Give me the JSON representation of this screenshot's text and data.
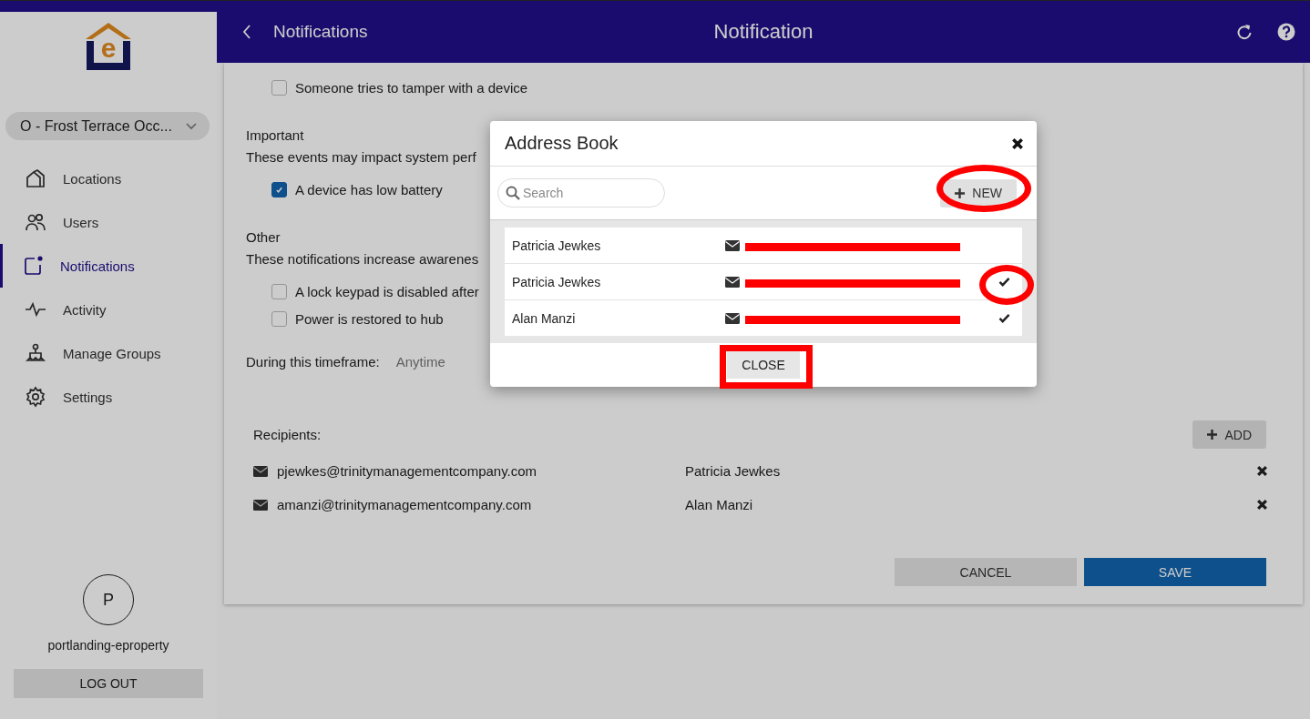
{
  "logo": {
    "letter": "e"
  },
  "location_selector": {
    "value": "O - Frost Terrace Occ..."
  },
  "sidebar": {
    "items": [
      {
        "label": "Locations",
        "selected": false
      },
      {
        "label": "Users",
        "selected": false
      },
      {
        "label": "Notifications",
        "selected": true
      },
      {
        "label": "Activity",
        "selected": false
      },
      {
        "label": "Manage Groups",
        "selected": false
      },
      {
        "label": "Settings",
        "selected": false
      }
    ]
  },
  "user": {
    "initial": "P",
    "name": "portlanding-eproperty",
    "logout": "LOG OUT"
  },
  "header": {
    "back_label": "Notifications",
    "title": "Notification"
  },
  "sections": [
    {
      "items": [
        {
          "label": "Someone tries to tamper with a device",
          "checked": false
        }
      ]
    },
    {
      "title": "Important",
      "description": "These events may impact system perf",
      "items": [
        {
          "label": "A device has low battery",
          "checked": true
        }
      ]
    },
    {
      "title": "Other",
      "description": "These notifications increase awarenes",
      "items": [
        {
          "label": "A lock keypad is disabled after",
          "checked": false
        },
        {
          "label": "Power is restored to hub",
          "checked": false
        }
      ]
    }
  ],
  "timeframe": {
    "label": "During this timeframe:",
    "value": "Anytime"
  },
  "recipients": {
    "label": "Recipients:",
    "add": "ADD",
    "items": [
      {
        "email": "pjewkes@trinitymanagementcompany.com",
        "name": "Patricia Jewkes"
      },
      {
        "email": "amanzi@trinitymanagementcompany.com",
        "name": "Alan Manzi"
      }
    ]
  },
  "actions": {
    "cancel": "CANCEL",
    "save": "SAVE"
  },
  "dialog": {
    "title": "Address Book",
    "search_placeholder": "Search",
    "new": "NEW",
    "close": "CLOSE",
    "contacts": [
      {
        "name": "Patricia Jewkes",
        "checked": false
      },
      {
        "name": "Patricia Jewkes",
        "checked": true
      },
      {
        "name": "Alan Manzi",
        "checked": true
      }
    ]
  }
}
